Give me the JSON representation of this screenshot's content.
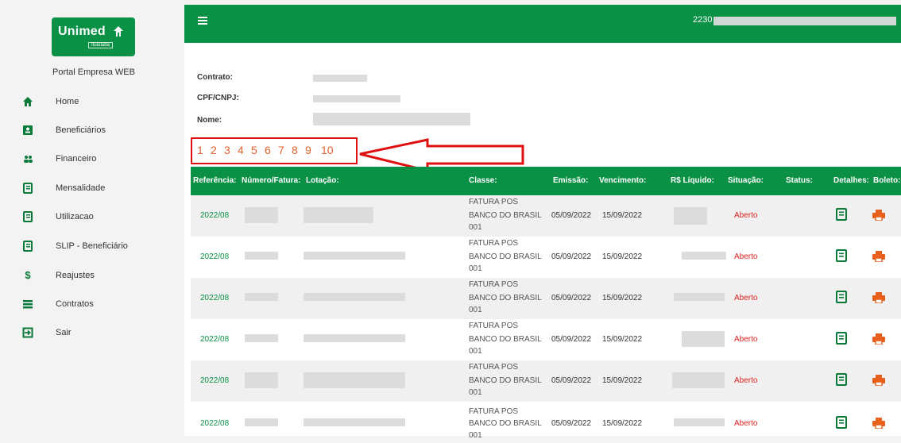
{
  "brand": {
    "logo": "Unimed",
    "logo_sub": "Ituiutaba",
    "portal": "Portal Empresa WEB",
    "color": "#0a9145"
  },
  "sidebar": {
    "items": [
      {
        "label": "Home",
        "icon": "home-icon"
      },
      {
        "label": "Beneficiários",
        "icon": "id-card-icon"
      },
      {
        "label": "Financeiro",
        "icon": "users-icon"
      },
      {
        "label": "Mensalidade",
        "icon": "document-icon"
      },
      {
        "label": "Utilizacao",
        "icon": "document-icon"
      },
      {
        "label": "SLIP - Beneficiário",
        "icon": "document-icon"
      },
      {
        "label": "Reajustes",
        "icon": "dollar-icon"
      },
      {
        "label": "Contratos",
        "icon": "list-icon"
      },
      {
        "label": "Sair",
        "icon": "exit-icon"
      }
    ]
  },
  "topbar": {
    "user_code": "2230"
  },
  "info": {
    "contrato_label": "Contrato:",
    "cpf_label": "CPF/CNPJ:",
    "nome_label": "Nome:"
  },
  "pagination": [
    "1",
    "2",
    "3",
    "4",
    "5",
    "6",
    "7",
    "8",
    "9",
    "10"
  ],
  "table": {
    "headers": {
      "referencia": "Referência:",
      "numero": "Número/Fatura:",
      "lotacao": "Lotação:",
      "classe": "Classe:",
      "emissao": "Emissão:",
      "vencimento": "Vencimento:",
      "liquido": "R$ Líquido:",
      "situacao": "Situação:",
      "status": "Status:",
      "detalhes": "Detalhes:",
      "boleto": "Boleto:"
    },
    "rows": [
      {
        "referencia": "2022/08",
        "classe1": "FATURA POS",
        "classe2": "BANCO DO BRASIL",
        "classe3": "001",
        "emissao": "05/09/2022",
        "vencimento": "15/09/2022",
        "situacao": "Aberto"
      },
      {
        "referencia": "2022/08",
        "classe1": "FATURA POS",
        "classe2": "BANCO DO BRASIL",
        "classe3": "001",
        "emissao": "05/09/2022",
        "vencimento": "15/09/2022",
        "situacao": "Aberto"
      },
      {
        "referencia": "2022/08",
        "classe1": "FATURA POS",
        "classe2": "BANCO DO BRASIL",
        "classe3": "001",
        "emissao": "05/09/2022",
        "vencimento": "15/09/2022",
        "situacao": "Aberto"
      },
      {
        "referencia": "2022/08",
        "classe1": "FATURA POS",
        "classe2": "BANCO DO BRASIL",
        "classe3": "001",
        "emissao": "05/09/2022",
        "vencimento": "15/09/2022",
        "situacao": "Aberto"
      },
      {
        "referencia": "2022/08",
        "classe1": "FATURA POS",
        "classe2": "BANCO DO BRASIL",
        "classe3": "001",
        "emissao": "05/09/2022",
        "vencimento": "15/09/2022",
        "situacao": "Aberto"
      },
      {
        "referencia": "2022/08",
        "classe1": "FATURA POS",
        "classe2": "BANCO DO BRASIL",
        "classe3": "001",
        "emissao": "05/09/2022",
        "vencimento": "15/09/2022",
        "situacao": "Aberto"
      }
    ]
  }
}
